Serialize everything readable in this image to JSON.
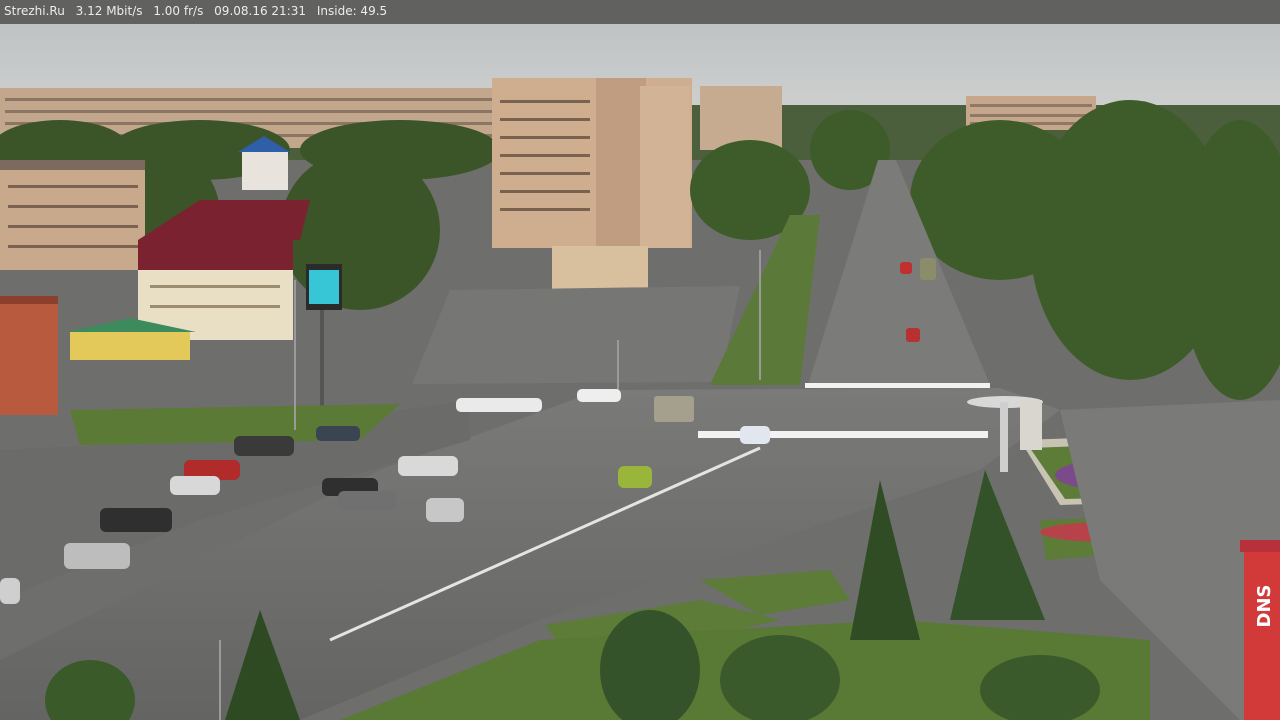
{
  "overlay": {
    "site": "Strezhi.Ru",
    "bitrate": "3.12 Mbit/s",
    "framerate": "1.00 fr/s",
    "datetime": "09.08.16 21:31",
    "inside": "Inside: 49.5"
  },
  "colors": {
    "sky": "#c4c8c9",
    "asphalt": "#6b6b6a",
    "trees": "#3e5b2c",
    "grass": "#5e7f3a",
    "building_tan": "#c6a88a",
    "overlay_bg": "#5f5f5f"
  },
  "billboard_sign": "DNS"
}
